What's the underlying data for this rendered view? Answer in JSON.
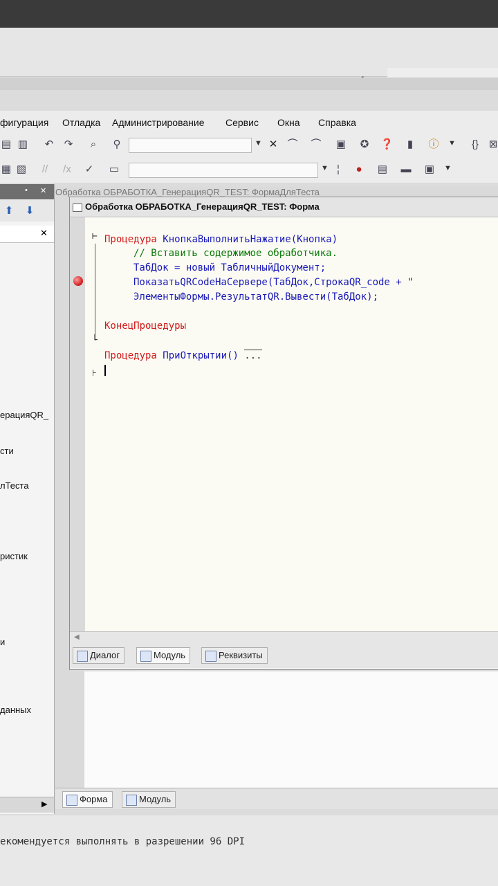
{
  "menu": {
    "items": [
      "фигурация",
      "Отладка",
      "Администрирование",
      "Сервис",
      "Окна",
      "Справка"
    ]
  },
  "outer_window": {
    "title": "Обработка ОБРАБОТКА_ГенерацияQR_TEST: ФормаДляТеста",
    "tabs": [
      "Форма",
      "Модуль"
    ]
  },
  "inner_window": {
    "title": "Обработка ОБРАБОТКА_ГенерацияQR_TEST: Форма",
    "tabs": [
      "Диалог",
      "Модуль",
      "Реквизиты"
    ]
  },
  "code": {
    "line1_kw": "Процедура",
    "line1_name": "КнопкаВыполнитьНажатие(Кнопка)",
    "line2_comment": "// Вставить содержимое обработчика.",
    "line3": "ТабДок = новый ТабличныйДокумент;",
    "line4": "ПоказатьQRCodeНаСервере(ТабДок,СтрокаQR_code + \"",
    "line5": "ЭлементыФормы.РезультатQR.Вывести(ТабДок);",
    "line6_kw": "КонецПроцедуры",
    "line7_kw": "Процедура",
    "line7_name": "ПриОткрытии()",
    "line7_collapsed": "..."
  },
  "left_panel": {
    "items": [
      "ерацияQR_",
      "сти",
      "лТеста",
      "ристик",
      "и",
      "данных"
    ]
  },
  "status": {
    "text": "екомендуется выполнять в разрешении 96 DPI"
  }
}
